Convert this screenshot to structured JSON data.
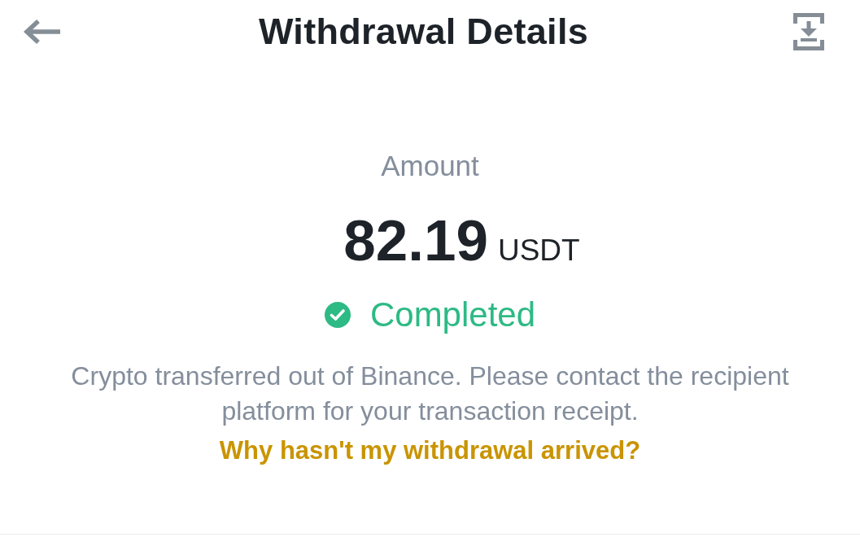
{
  "header": {
    "title": "Withdrawal Details"
  },
  "amount": {
    "label": "Amount",
    "value": "82.19",
    "currency": "USDT"
  },
  "status": {
    "kind": "completed",
    "label": "Completed"
  },
  "description": "Crypto transferred out of Binance. Please contact the recipient platform for your transaction receipt.",
  "help_link": "Why hasn't my withdrawal arrived?"
}
